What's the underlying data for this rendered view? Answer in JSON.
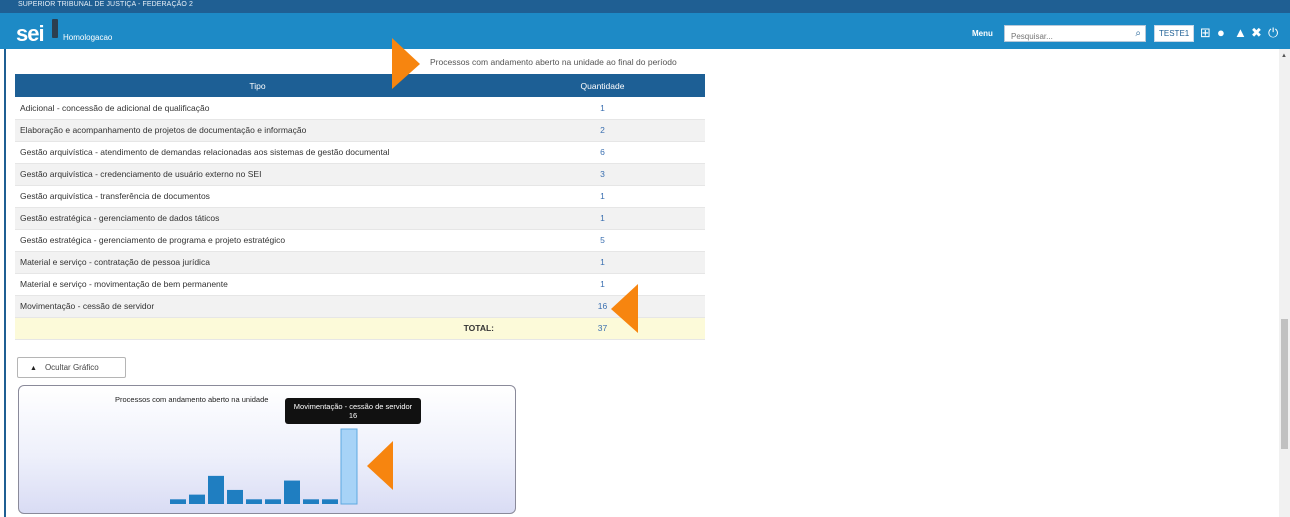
{
  "app": {
    "org_title": "SUPERIOR TRIBUNAL DE JUSTIÇA - FEDERAÇÃO 2",
    "logo": "sei",
    "environment": "Homologacao",
    "menu_label": "Menu",
    "search_placeholder": "Pesquisar...",
    "user_badge": "TESTE1",
    "icons": [
      "grid-icon",
      "info-icon",
      "user-icon",
      "tools-icon",
      "power-icon"
    ]
  },
  "report": {
    "title": "Processos com andamento aberto na unidade ao final do período",
    "columns": [
      "Tipo",
      "Quantidade"
    ],
    "rows": [
      {
        "tipo": "Adicional - concessão de adicional de qualificação",
        "quantidade": "1"
      },
      {
        "tipo": "Elaboração e acompanhamento de projetos de documentação e informação",
        "quantidade": "2"
      },
      {
        "tipo": "Gestão arquivística - atendimento de demandas relacionadas aos sistemas de gestão documental",
        "quantidade": "6"
      },
      {
        "tipo": "Gestão arquivística - credenciamento de usuário externo no SEI",
        "quantidade": "3"
      },
      {
        "tipo": "Gestão arquivística - transferência de documentos",
        "quantidade": "1"
      },
      {
        "tipo": "Gestão estratégica - gerenciamento de dados táticos",
        "quantidade": "1"
      },
      {
        "tipo": "Gestão estratégica - gerenciamento de programa e projeto estratégico",
        "quantidade": "5"
      },
      {
        "tipo": "Material e serviço - contratação de pessoa jurídica",
        "quantidade": "1"
      },
      {
        "tipo": "Material e serviço - movimentação de bem permanente",
        "quantidade": "1"
      },
      {
        "tipo": "Movimentação - cessão de servidor",
        "quantidade": "16"
      }
    ],
    "total_label": "TOTAL:",
    "total_value": "37"
  },
  "chart_toggle_label": "Ocultar Gráfico",
  "chart_data": {
    "type": "bar",
    "title": "Processos com andamento aberto na unidade",
    "categories": [
      "Adicional - concessão de adicional de qualificação",
      "Elaboração e acompanhamento de projetos de documentação e informação",
      "Gestão arquivística - atendimento de demandas relacionadas aos sistemas de gestão documental",
      "Gestão arquivística - credenciamento de usuário externo no SEI",
      "Gestão arquivística - transferência de documentos",
      "Gestão estratégica - gerenciamento de dados táticos",
      "Gestão estratégica - gerenciamento de programa e projeto estratégico",
      "Material e serviço - contratação de pessoa jurídica",
      "Material e serviço - movimentação de bem permanente",
      "Movimentação - cessão de servidor"
    ],
    "values": [
      1,
      2,
      6,
      3,
      1,
      1,
      5,
      1,
      1,
      16
    ],
    "highlighted_index": 9,
    "ylim": [
      0,
      16
    ],
    "grid": false,
    "tooltip": {
      "label": "Movimentação - cessão de servidor",
      "value": "16"
    },
    "colors": {
      "bar": "#1f7ec1",
      "highlight": "#a7d3f7"
    }
  },
  "colors": {
    "header": "#1d8ac6",
    "table_header": "#1d5f95",
    "total_row": "#fcfad9",
    "annotation_arrow": "#f7850f"
  }
}
